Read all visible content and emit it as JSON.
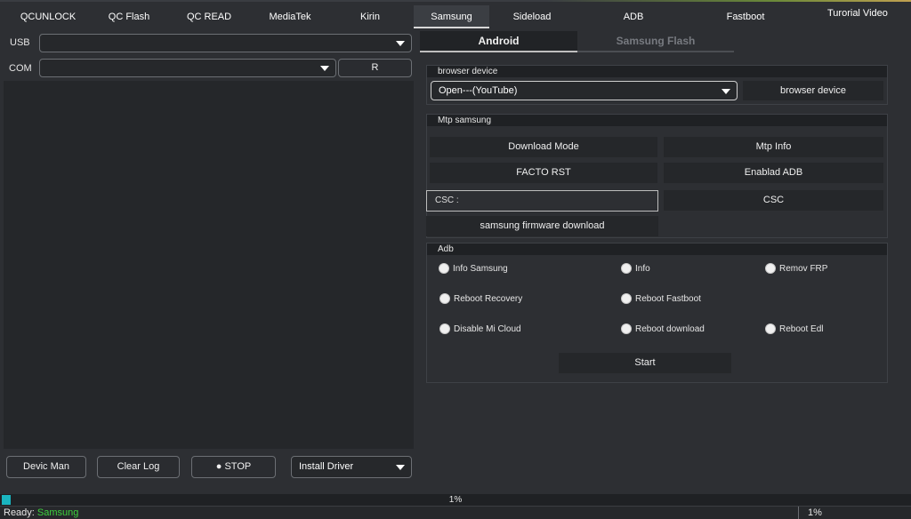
{
  "tabs": [
    {
      "label": "QCUNLOCK"
    },
    {
      "label": "QC Flash"
    },
    {
      "label": "QC READ"
    },
    {
      "label": "MediaTek"
    },
    {
      "label": "Kirin"
    },
    {
      "label": "Samsung"
    },
    {
      "label": "Sideload"
    },
    {
      "label": "ADB"
    },
    {
      "label": "Fastboot"
    }
  ],
  "active_tab": "Samsung",
  "tutorial_label": "Turorial Video",
  "left": {
    "usb_label": "USB",
    "usb_value": "",
    "com_label": "COM",
    "com_value": "",
    "refresh_label": "R",
    "buttons": {
      "device_manager": "Devic Man",
      "clear_log": "Clear Log",
      "stop": "● STOP",
      "install_driver": "Install Driver"
    }
  },
  "right": {
    "subtabs": {
      "android": "Android",
      "samsung_flash": "Samsung Flash"
    },
    "browser_group": {
      "title": "browser device",
      "select_value": "Open---(YouTube)",
      "button": "browser device"
    },
    "mtp_group": {
      "title": "Mtp samsung",
      "download_mode": "Download Mode",
      "mtp_info": "Mtp Info",
      "facto_rst": "FACTO RST",
      "enable_adb": "Enablad ADB",
      "csc_placeholder": "CSC :",
      "csc_button": "CSC",
      "firmware_download": "samsung firmware download"
    },
    "adb_group": {
      "title": "Adb",
      "options": [
        "Info Samsung",
        "Info",
        "Remov FRP",
        "Reboot Recovery",
        "Reboot Fastboot",
        "Disable Mi Cloud",
        "Reboot download",
        "Reboot Edl"
      ],
      "start": "Start"
    }
  },
  "progress": {
    "percent_label": "1%",
    "value": 0.01
  },
  "status": {
    "ready": "Ready:",
    "device": "Samsung",
    "percent": "1%"
  },
  "colors": {
    "accent_progress": "#1ab5c0",
    "status_device": "#3dd23d"
  }
}
